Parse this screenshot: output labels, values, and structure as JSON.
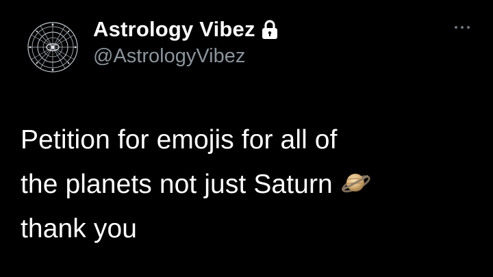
{
  "author": {
    "display_name": "Astrology Vibez",
    "handle": "@AstrologyVibez",
    "avatar_icon": "zodiac-wheel-avatar",
    "protected_icon": "lock-icon"
  },
  "menu": {
    "icon": "more-options-icon"
  },
  "tweet": {
    "lines": [
      "Petition for emojis for all of",
      "the planets not just Saturn",
      "thank you"
    ],
    "emoji": "saturn-emoji"
  },
  "colors": {
    "background": "#000000",
    "primary_text": "#ffffff",
    "secondary_text": "#8b949c"
  }
}
